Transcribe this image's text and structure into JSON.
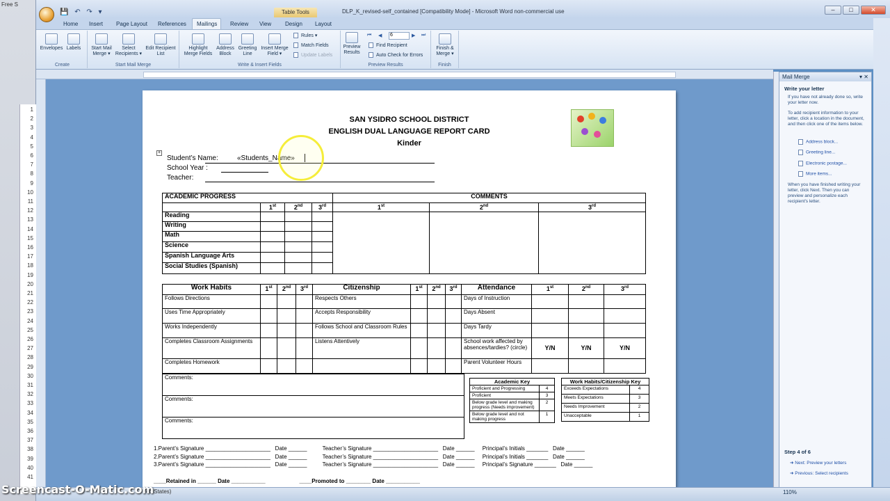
{
  "left_window": {
    "title_fragment": "Free S"
  },
  "title_bar": {
    "table_tools": "Table Tools",
    "document_title": "DLP_K_revised-self_contained [Compatibility Mode] - Microsoft Word non-commercial use",
    "controls": {
      "minimize": "–",
      "maximize": "□",
      "close": "✕"
    }
  },
  "ribbon_tabs": [
    {
      "label": "Home"
    },
    {
      "label": "Insert"
    },
    {
      "label": "Page Layout"
    },
    {
      "label": "References"
    },
    {
      "label": "Mailings"
    },
    {
      "label": "Review"
    },
    {
      "label": "View"
    },
    {
      "label": "Design"
    },
    {
      "label": "Layout"
    }
  ],
  "ribbon": {
    "groups": {
      "create": "Create",
      "start_mail_merge": "Start Mail Merge",
      "write_insert": "Write & Insert Fields",
      "preview_results": "Preview Results",
      "finish": "Finish"
    },
    "buttons": {
      "envelopes": "Envelopes",
      "labels": "Labels",
      "start_mail_merge": "Start Mail Merge ▾",
      "select_recipients": "Select Recipients ▾",
      "edit_recipient_list": "Edit Recipient List",
      "highlight_merge_fields": "Highlight Merge Fields",
      "address_block": "Address Block",
      "greeting_line": "Greeting Line",
      "insert_merge_field": "Insert Merge Field ▾",
      "rules": "Rules ▾",
      "match_fields": "Match Fields",
      "update_labels": "Update Labels",
      "preview_results": "Preview Results",
      "record_number": "6",
      "find_recipient": "Find Recipient",
      "auto_check": "Auto Check for Errors",
      "finish_merge": "Finish & Merge ▾"
    }
  },
  "document": {
    "heading1": "SAN YSIDRO SCHOOL DISTRICT",
    "heading2": "ENGLISH DUAL LANGUAGE REPORT CARD",
    "heading3": "Kinder",
    "student_name_label": "Student’s Name:",
    "student_name_field": "«Students_Name»",
    "school_year_label": "School Year :",
    "teacher_label": "Teacher:",
    "academic": {
      "title": "ACADEMIC PROGRESS",
      "comments_title": "COMMENTS",
      "periods": [
        "1",
        "2",
        "3"
      ],
      "period_suffixes": [
        "st",
        "nd",
        "rd"
      ],
      "subjects": [
        "Reading",
        "Writing",
        "Math",
        "Science",
        "Spanish Language Arts",
        "Social Studies (Spanish)"
      ]
    },
    "habits": {
      "work_habits_title": "Work Habits",
      "citizenship_title": "Citizenship",
      "attendance_title": "Attendance",
      "rows": [
        {
          "work": "Follows Directions",
          "cit": "Respects Others",
          "att": "Days of Instruction",
          "yn": ""
        },
        {
          "work": "Uses Time Appropriately",
          "cit": "Accepts Responsibility",
          "att": "Days Absent",
          "yn": ""
        },
        {
          "work": "Works Independently",
          "cit": "Follows School and Classroom Rules",
          "att": "Days Tardy",
          "yn": ""
        },
        {
          "work": "Completes Classroom Assignments",
          "cit": "Listens Attentively",
          "att": "School work affected by absences/tardies? (circle)",
          "yn": "Y/N"
        },
        {
          "work": "Completes Homework",
          "cit": "",
          "att": "Parent Volunteer Hours",
          "yn": ""
        }
      ]
    },
    "comments_labels": [
      "Comments:",
      "Comments:",
      "Comments:"
    ],
    "academic_key": {
      "title": "Academic Key",
      "rows": [
        {
          "label": "Proficient and Progressing",
          "value": "4"
        },
        {
          "label": "Proficient",
          "value": "3"
        },
        {
          "label": "Below grade level and making progress (Needs improvement)",
          "value": "2"
        },
        {
          "label": "Below grade level and not making progress",
          "value": "1"
        }
      ]
    },
    "work_key": {
      "title": "Work Habits/Citizenship Key",
      "rows": [
        {
          "label": "Exceeds Expectations",
          "value": "4"
        },
        {
          "label": "Meets Expectations",
          "value": "3"
        },
        {
          "label": "Needs Improvement",
          "value": "2"
        },
        {
          "label": "Unacceptable",
          "value": "1"
        }
      ]
    },
    "signatures": {
      "parent": [
        "1.Parent’s Signature",
        "2.Parent’s Signature",
        "3.Parent’s Signature"
      ],
      "date": "Date",
      "teacher": "Teacher’s Signature",
      "principal_initials": "Principal’s Initials",
      "principal_signature": "Principal’s Signature"
    },
    "retained": "Retained in",
    "promoted": "Promoted to"
  },
  "mail_merge_pane": {
    "title": "Mail Merge",
    "section": "Write your letter",
    "intro": "If you have not already done so, write your letter now.",
    "instructions": "To add recipient information to your letter, click a location in the document, and then click one of the items below.",
    "links": [
      "Address block...",
      "Greeting line...",
      "Electronic postage...",
      "More items..."
    ],
    "finished": "When you have finished writing your letter, click Next. Then you can preview and personalize each recipient's letter.",
    "step": "Step 4 of 6",
    "next": "Next: Preview your letters",
    "previous": "Previous: Select recipients"
  },
  "status_bar": {
    "language": "ed States)",
    "zoom": "110%"
  },
  "watermark": "Screencast-O-Matic.com"
}
